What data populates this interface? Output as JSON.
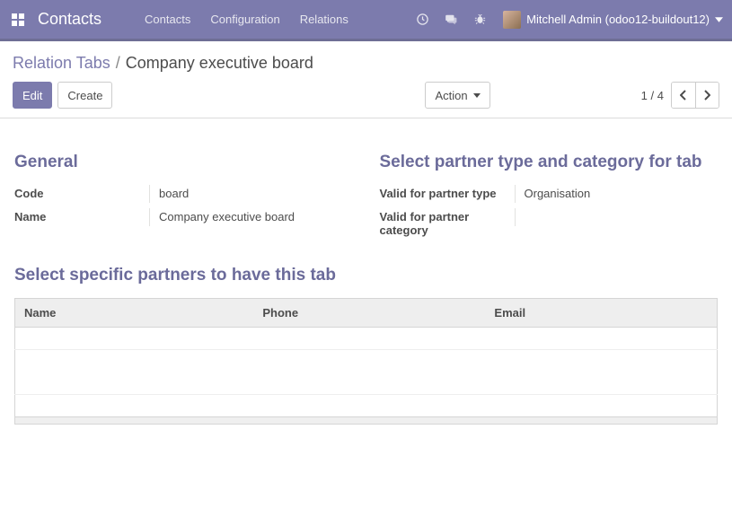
{
  "navbar": {
    "brand": "Contacts",
    "links": [
      "Contacts",
      "Configuration",
      "Relations"
    ],
    "user_name": "Mitchell Admin (odoo12-buildout12)"
  },
  "breadcrumb": {
    "parent": "Relation Tabs",
    "current": "Company executive board"
  },
  "buttons": {
    "edit": "Edit",
    "create": "Create",
    "action": "Action"
  },
  "pager": {
    "position": "1",
    "total": "4"
  },
  "sections": {
    "general_title": "General",
    "select_type_title": "Select partner type and category for tab",
    "select_partners_title": "Select specific partners to have this tab"
  },
  "fields": {
    "code_label": "Code",
    "code_value": "board",
    "name_label": "Name",
    "name_value": "Company executive board",
    "valid_type_label": "Valid for partner type",
    "valid_type_value": "Organisation",
    "valid_cat_label": "Valid for partner category",
    "valid_cat_value": ""
  },
  "table": {
    "col_name": "Name",
    "col_phone": "Phone",
    "col_email": "Email"
  }
}
